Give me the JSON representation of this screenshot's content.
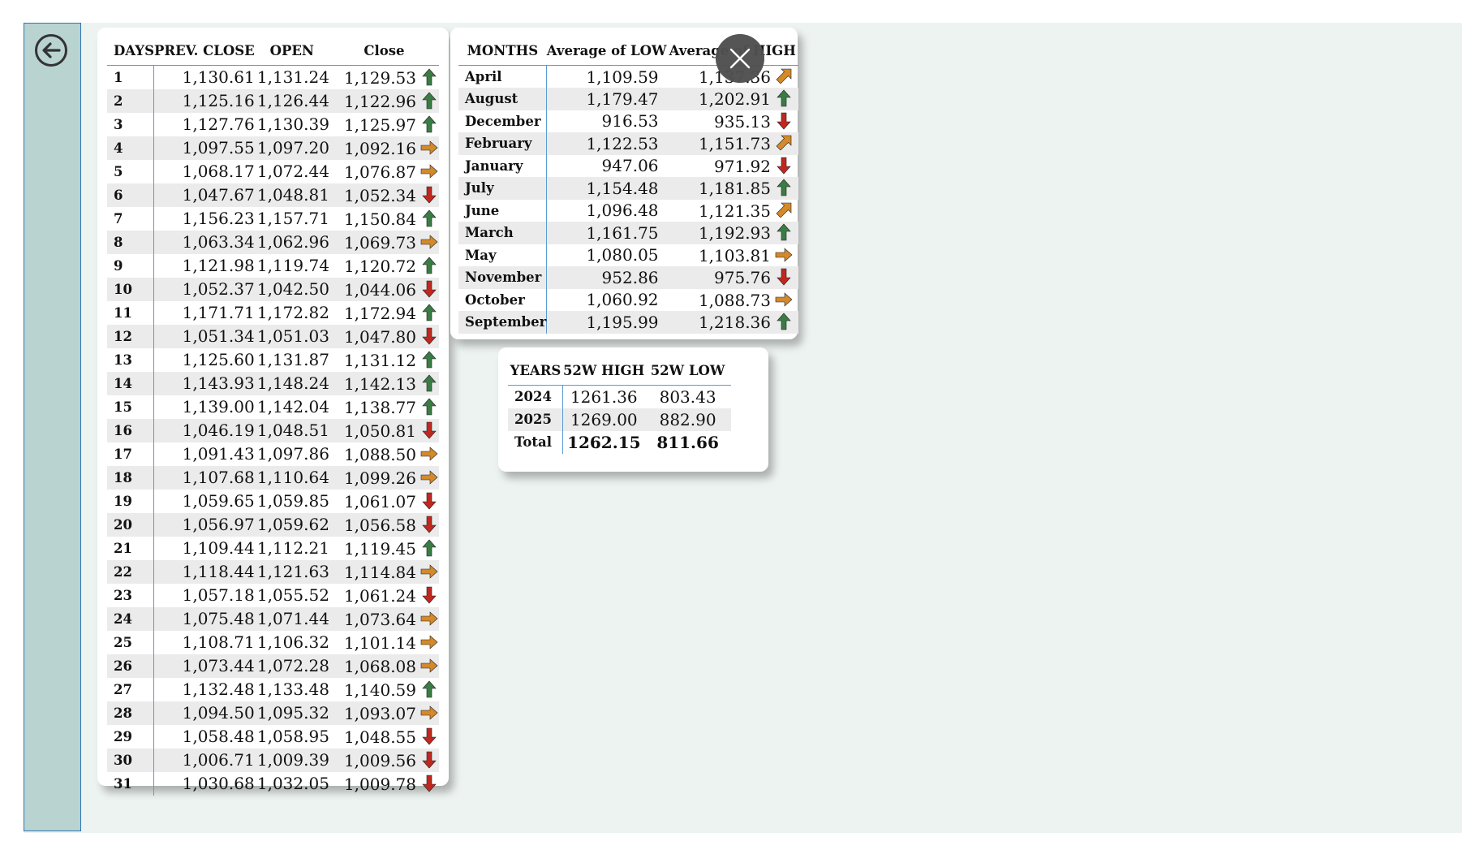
{
  "days_table": {
    "headers": [
      "DAYS",
      "PREV. CLOSE",
      "OPEN",
      "Close"
    ],
    "rows": [
      {
        "day": "1",
        "prev": "1,130.61",
        "open": "1,131.24",
        "close": "1,129.53",
        "trend": "up"
      },
      {
        "day": "2",
        "prev": "1,125.16",
        "open": "1,126.44",
        "close": "1,122.96",
        "trend": "up"
      },
      {
        "day": "3",
        "prev": "1,127.76",
        "open": "1,130.39",
        "close": "1,125.97",
        "trend": "up"
      },
      {
        "day": "4",
        "prev": "1,097.55",
        "open": "1,097.20",
        "close": "1,092.16",
        "trend": "right"
      },
      {
        "day": "5",
        "prev": "1,068.17",
        "open": "1,072.44",
        "close": "1,076.87",
        "trend": "right"
      },
      {
        "day": "6",
        "prev": "1,047.67",
        "open": "1,048.81",
        "close": "1,052.34",
        "trend": "down"
      },
      {
        "day": "7",
        "prev": "1,156.23",
        "open": "1,157.71",
        "close": "1,150.84",
        "trend": "up"
      },
      {
        "day": "8",
        "prev": "1,063.34",
        "open": "1,062.96",
        "close": "1,069.73",
        "trend": "right"
      },
      {
        "day": "9",
        "prev": "1,121.98",
        "open": "1,119.74",
        "close": "1,120.72",
        "trend": "up"
      },
      {
        "day": "10",
        "prev": "1,052.37",
        "open": "1,042.50",
        "close": "1,044.06",
        "trend": "down"
      },
      {
        "day": "11",
        "prev": "1,171.71",
        "open": "1,172.82",
        "close": "1,172.94",
        "trend": "up"
      },
      {
        "day": "12",
        "prev": "1,051.34",
        "open": "1,051.03",
        "close": "1,047.80",
        "trend": "down"
      },
      {
        "day": "13",
        "prev": "1,125.60",
        "open": "1,131.87",
        "close": "1,131.12",
        "trend": "up"
      },
      {
        "day": "14",
        "prev": "1,143.93",
        "open": "1,148.24",
        "close": "1,142.13",
        "trend": "up"
      },
      {
        "day": "15",
        "prev": "1,139.00",
        "open": "1,142.04",
        "close": "1,138.77",
        "trend": "up"
      },
      {
        "day": "16",
        "prev": "1,046.19",
        "open": "1,048.51",
        "close": "1,050.81",
        "trend": "down"
      },
      {
        "day": "17",
        "prev": "1,091.43",
        "open": "1,097.86",
        "close": "1,088.50",
        "trend": "right"
      },
      {
        "day": "18",
        "prev": "1,107.68",
        "open": "1,110.64",
        "close": "1,099.26",
        "trend": "right"
      },
      {
        "day": "19",
        "prev": "1,059.65",
        "open": "1,059.85",
        "close": "1,061.07",
        "trend": "down"
      },
      {
        "day": "20",
        "prev": "1,056.97",
        "open": "1,059.62",
        "close": "1,056.58",
        "trend": "down"
      },
      {
        "day": "21",
        "prev": "1,109.44",
        "open": "1,112.21",
        "close": "1,119.45",
        "trend": "up"
      },
      {
        "day": "22",
        "prev": "1,118.44",
        "open": "1,121.63",
        "close": "1,114.84",
        "trend": "right"
      },
      {
        "day": "23",
        "prev": "1,057.18",
        "open": "1,055.52",
        "close": "1,061.24",
        "trend": "down"
      },
      {
        "day": "24",
        "prev": "1,075.48",
        "open": "1,071.44",
        "close": "1,073.64",
        "trend": "right"
      },
      {
        "day": "25",
        "prev": "1,108.71",
        "open": "1,106.32",
        "close": "1,101.14",
        "trend": "right"
      },
      {
        "day": "26",
        "prev": "1,073.44",
        "open": "1,072.28",
        "close": "1,068.08",
        "trend": "right"
      },
      {
        "day": "27",
        "prev": "1,132.48",
        "open": "1,133.48",
        "close": "1,140.59",
        "trend": "up"
      },
      {
        "day": "28",
        "prev": "1,094.50",
        "open": "1,095.32",
        "close": "1,093.07",
        "trend": "right"
      },
      {
        "day": "29",
        "prev": "1,058.48",
        "open": "1,058.95",
        "close": "1,048.55",
        "trend": "down"
      },
      {
        "day": "30",
        "prev": "1,006.71",
        "open": "1,009.39",
        "close": "1,009.56",
        "trend": "down"
      },
      {
        "day": "31",
        "prev": "1,030.68",
        "open": "1,032.05",
        "close": "1,009.78",
        "trend": "down"
      }
    ]
  },
  "months_table": {
    "headers": [
      "MONTHS",
      "Average of LOW",
      "Average of HIGH"
    ],
    "rows": [
      {
        "month": "April",
        "low": "1,109.59",
        "high": "1,137.36",
        "trend": "up-right"
      },
      {
        "month": "August",
        "low": "1,179.47",
        "high": "1,202.91",
        "trend": "up"
      },
      {
        "month": "December",
        "low": "916.53",
        "high": "935.13",
        "trend": "down"
      },
      {
        "month": "February",
        "low": "1,122.53",
        "high": "1,151.73",
        "trend": "up-right"
      },
      {
        "month": "January",
        "low": "947.06",
        "high": "971.92",
        "trend": "down"
      },
      {
        "month": "July",
        "low": "1,154.48",
        "high": "1,181.85",
        "trend": "up"
      },
      {
        "month": "June",
        "low": "1,096.48",
        "high": "1,121.35",
        "trend": "up-right"
      },
      {
        "month": "March",
        "low": "1,161.75",
        "high": "1,192.93",
        "trend": "up"
      },
      {
        "month": "May",
        "low": "1,080.05",
        "high": "1,103.81",
        "trend": "right"
      },
      {
        "month": "November",
        "low": "952.86",
        "high": "975.76",
        "trend": "down"
      },
      {
        "month": "October",
        "low": "1,060.92",
        "high": "1,088.73",
        "trend": "right"
      },
      {
        "month": "September",
        "low": "1,195.99",
        "high": "1,218.36",
        "trend": "up"
      }
    ]
  },
  "years_table": {
    "headers": [
      "YEARS",
      "52W HIGH",
      "52W LOW"
    ],
    "rows": [
      {
        "year": "2024",
        "high": "1261.36",
        "low": "803.43"
      },
      {
        "year": "2025",
        "high": "1269.00",
        "low": "882.90"
      }
    ],
    "total": {
      "label": "Total",
      "high": "1262.15",
      "low": "811.66"
    }
  },
  "colors": {
    "up": "#3a7d44",
    "down": "#c0281f",
    "right": "#d4892a",
    "up-right": "#d4892a",
    "sidebar": "#b9d3d1",
    "canvas": "#edf3f1"
  },
  "icons": {
    "back": "circle-arrow-left-icon",
    "close": "close-x-icon"
  }
}
